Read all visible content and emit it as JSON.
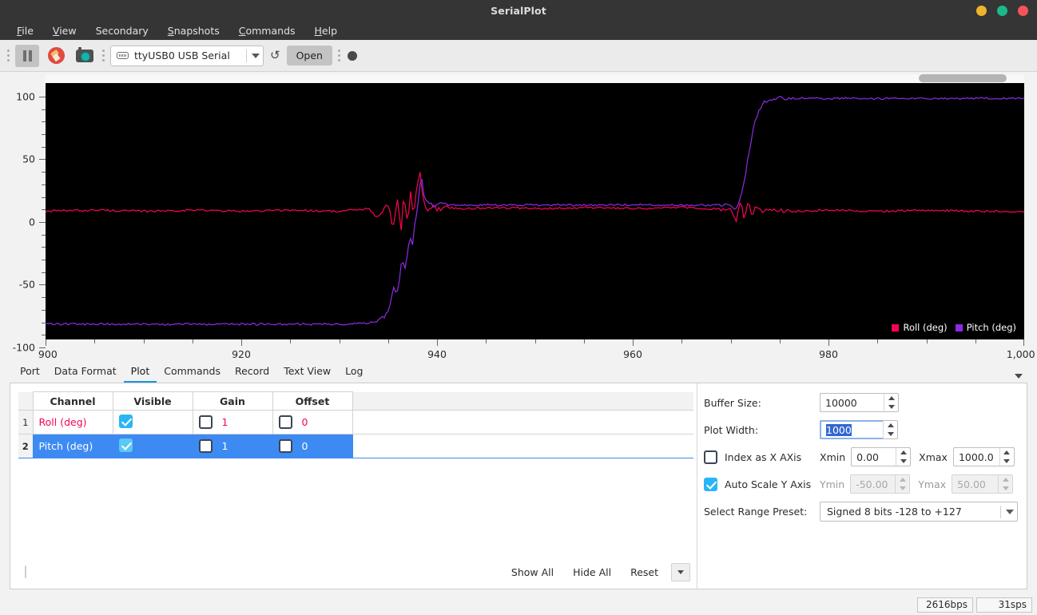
{
  "window": {
    "title": "SerialPlot",
    "controls": {
      "minimize": "minimize",
      "maximize": "maximize",
      "close": "close"
    }
  },
  "menubar": {
    "items": [
      {
        "label": "File",
        "mnemonic": "F"
      },
      {
        "label": "View",
        "mnemonic": "V"
      },
      {
        "label": "Secondary",
        "mnemonic": "S"
      },
      {
        "label": "Snapshots",
        "mnemonic": "S"
      },
      {
        "label": "Commands",
        "mnemonic": "C"
      },
      {
        "label": "Help",
        "mnemonic": "H"
      }
    ]
  },
  "toolbar": {
    "pause_label": "pause",
    "clear_label": "clear",
    "snapshot_label": "snapshot",
    "port_value": "ttyUSB0 USB Serial",
    "refresh_glyph": "↺",
    "open_label": "Open",
    "record_label": "record"
  },
  "plot": {
    "scrollbar": "horizontal-scrollbar",
    "legend": [
      {
        "label": "Roll (deg)",
        "color": "#f5054f"
      },
      {
        "label": "Pitch (deg)",
        "color": "#8b2be2"
      }
    ],
    "background": "#000000"
  },
  "chart_data": {
    "type": "line",
    "title": "",
    "xlabel": "",
    "ylabel": "",
    "xlim": [
      900,
      1000
    ],
    "ylim": [
      -100,
      100
    ],
    "xticks": [
      900,
      920,
      940,
      960,
      980,
      1000
    ],
    "xtick_labels": [
      "900",
      "920",
      "940",
      "960",
      "980",
      "1,000"
    ],
    "xtick_minor_step": 5,
    "yticks": [
      100,
      50,
      0,
      -50,
      -100
    ],
    "ytick_labels": [
      "100",
      "50",
      "0",
      "-50",
      "-100"
    ],
    "ytick_minor_step": 10,
    "grid": false,
    "legend_position": "bottom-right",
    "series": [
      {
        "name": "Roll (deg)",
        "color": "#f5054f",
        "x": [
          900,
          905,
          910,
          915,
          920,
          925,
          930,
          933,
          934,
          935,
          935.5,
          936,
          936.3,
          936.6,
          937,
          937.3,
          937.6,
          938,
          938.3,
          938.6,
          939,
          939.4,
          940,
          941,
          943,
          946,
          950,
          955,
          960,
          965,
          968,
          970,
          970.6,
          971,
          971.4,
          971.8,
          972.2,
          972.6,
          973,
          974,
          976,
          980,
          985,
          990,
          995,
          1000
        ],
        "y": [
          0,
          1,
          0,
          1,
          0,
          1,
          0,
          2,
          -6,
          6,
          -14,
          10,
          -18,
          12,
          -10,
          16,
          -6,
          24,
          30,
          8,
          2,
          4,
          2,
          3,
          2,
          3,
          2,
          3,
          2,
          3,
          2,
          1,
          -7,
          8,
          -6,
          7,
          -4,
          5,
          0,
          1,
          0,
          1,
          0,
          1,
          0,
          0
        ]
      },
      {
        "name": "Pitch (deg)",
        "color": "#8b2be2",
        "x": [
          900,
          905,
          910,
          915,
          920,
          925,
          930,
          933,
          934,
          935,
          935.5,
          936,
          936.4,
          936.8,
          937.2,
          937.5,
          937.8,
          938.1,
          938.4,
          938.7,
          939,
          939.5,
          940,
          942,
          945,
          950,
          955,
          960,
          965,
          968,
          970,
          970.5,
          971,
          971.5,
          972,
          972.5,
          973,
          973.5,
          974,
          975,
          976,
          978,
          980,
          985,
          990,
          995,
          1000
        ],
        "y": [
          -88,
          -88,
          -88,
          -88,
          -88,
          -88,
          -88,
          -87,
          -86,
          -80,
          -60,
          -62,
          -40,
          -44,
          -20,
          -26,
          -6,
          8,
          30,
          10,
          6,
          5,
          5,
          5,
          5,
          5,
          5,
          5,
          5,
          5,
          5,
          2,
          10,
          28,
          52,
          70,
          80,
          85,
          87,
          88,
          88,
          88,
          88,
          88,
          88,
          88,
          88
        ]
      }
    ]
  },
  "tabs": {
    "items": [
      "Port",
      "Data Format",
      "Plot",
      "Commands",
      "Record",
      "Text View",
      "Log"
    ],
    "active": "Plot"
  },
  "channel_table": {
    "headers": [
      "Channel",
      "Visible",
      "Gain",
      "Offset"
    ],
    "rows": [
      {
        "num": "1",
        "channel": "Roll (deg)",
        "color": "#f5054f",
        "visible": true,
        "gain_enabled": false,
        "gain": "1",
        "offset_enabled": false,
        "offset": "0",
        "selected": false
      },
      {
        "num": "2",
        "channel": "Pitch (deg)",
        "color": "#ffffff",
        "visible": true,
        "gain_enabled": false,
        "gain": "1",
        "offset_enabled": false,
        "offset": "0",
        "selected": true
      }
    ],
    "select_all_checked": false
  },
  "actions": {
    "show_all": "Show All",
    "hide_all": "Hide All",
    "reset": "Reset",
    "more": "more-options"
  },
  "settings": {
    "buffer_size_label": "Buffer Size:",
    "buffer_size_value": "10000",
    "plot_width_label": "Plot Width:",
    "plot_width_value": "1000",
    "index_as_x_label": "Index as X AXis",
    "index_as_x_checked": false,
    "xmin_label": "Xmin",
    "xmin_value": "0.00",
    "xmax_label": "Xmax",
    "xmax_value": "1000.0",
    "auto_scale_label": "Auto Scale Y Axis",
    "auto_scale_checked": true,
    "ymin_label": "Ymin",
    "ymin_value": "-50.00",
    "ymax_label": "Ymax",
    "ymax_value": "50.00",
    "range_preset_label": "Select Range Preset:",
    "range_preset_value": "Signed 8 bits -128 to +127"
  },
  "statusbar": {
    "bps": "2616bps",
    "sps": "31sps"
  }
}
